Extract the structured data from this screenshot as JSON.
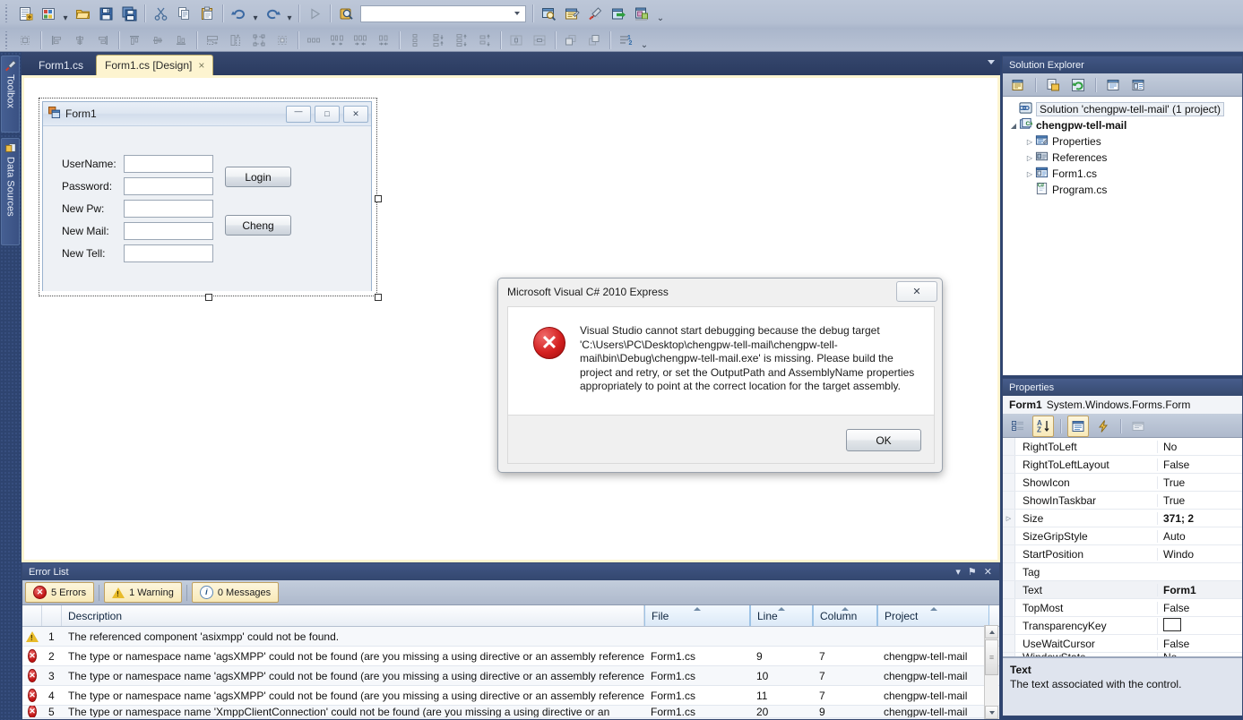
{
  "toolbars": {
    "row1_icons": [
      "new-project-icon",
      "add-new-item-icon",
      "open-file-icon",
      "save-icon",
      "save-all-icon",
      "cut-icon",
      "copy-icon",
      "paste-icon",
      "undo-icon",
      "redo-icon",
      "start-debugging-icon",
      "find-in-files-icon",
      "navigate-combo",
      "solution-explorer-icon",
      "properties-window-icon",
      "toolbox-icon",
      "object-browser-icon",
      "error-list-icon"
    ],
    "row2_icons": [
      "align-to-grid-icon",
      "align-lefts-icon",
      "align-centers-icon",
      "align-rights-icon",
      "align-tops-icon",
      "align-middles-icon",
      "align-bottoms-icon",
      "make-same-width-icon",
      "make-same-height-icon",
      "make-same-size-icon",
      "size-to-grid-icon",
      "horizontal-spacing-equal-icon",
      "horizontal-spacing-increase-icon",
      "horizontal-spacing-decrease-icon",
      "horizontal-spacing-remove-icon",
      "vertical-spacing-equal-icon",
      "vertical-spacing-increase-icon",
      "vertical-spacing-decrease-icon",
      "vertical-spacing-remove-icon",
      "center-horizontally-icon",
      "center-vertically-icon",
      "bring-to-front-icon",
      "send-to-back-icon",
      "tab-order-icon"
    ],
    "combo_value": "",
    "combo_placeholder": ""
  },
  "left_dock": {
    "tabs": [
      {
        "label": "Toolbox",
        "icon": "toolbox-icon"
      },
      {
        "label": "Data Sources",
        "icon": "data-sources-icon"
      }
    ]
  },
  "doc_tabs": [
    {
      "label": "Form1.cs",
      "active": false,
      "closable": false
    },
    {
      "label": "Form1.cs [Design]",
      "active": true,
      "closable": true,
      "close_glyph": "×"
    }
  ],
  "designer": {
    "form": {
      "title": "Form1",
      "icon": "winforms-form-icon",
      "window_buttons": [
        {
          "name": "minimize-button",
          "glyph": "—"
        },
        {
          "name": "maximize-button",
          "glyph": "□"
        },
        {
          "name": "close-button",
          "glyph": "✕"
        }
      ],
      "fields": [
        {
          "label": "UserName:",
          "value": ""
        },
        {
          "label": "Password:",
          "value": ""
        },
        {
          "label": "New Pw:",
          "value": ""
        },
        {
          "label": "New Mail:",
          "value": ""
        },
        {
          "label": "New Tell:",
          "value": ""
        }
      ],
      "buttons": [
        {
          "label": "Login"
        },
        {
          "label": "Cheng"
        }
      ]
    }
  },
  "dialog": {
    "title": "Microsoft Visual C# 2010 Express",
    "close_glyph": "✕",
    "icon": "error-icon",
    "message": "Visual Studio cannot start debugging because the debug target 'C:\\Users\\PC\\Desktop\\chengpw-tell-mail\\chengpw-tell-mail\\bin\\Debug\\chengpw-tell-mail.exe' is missing. Please build the project and retry, or set the OutputPath and AssemblyName properties appropriately to point at the correct location for the target assembly.",
    "ok_label": "OK"
  },
  "solution_explorer": {
    "title": "Solution Explorer",
    "toolbar_icons": [
      "properties-window-icon",
      "show-all-files-icon",
      "refresh-icon",
      "view-code-icon",
      "view-designer-icon"
    ],
    "tree": [
      {
        "label": "Solution 'chengpw-tell-mail' (1 project)",
        "icon": "solution-icon",
        "depth": 0,
        "twisty": "",
        "selected": true,
        "bold": false
      },
      {
        "label": "chengpw-tell-mail",
        "icon": "csharp-project-icon",
        "depth": 0,
        "twisty": "◢",
        "selected": false,
        "bold": true
      },
      {
        "label": "Properties",
        "icon": "properties-folder-icon",
        "depth": 1,
        "twisty": "▷",
        "selected": false,
        "bold": false
      },
      {
        "label": "References",
        "icon": "references-folder-icon",
        "depth": 1,
        "twisty": "▷",
        "selected": false,
        "bold": false
      },
      {
        "label": "Form1.cs",
        "icon": "form-file-icon",
        "depth": 1,
        "twisty": "▷",
        "selected": false,
        "bold": false
      },
      {
        "label": "Program.cs",
        "icon": "csharp-file-icon",
        "depth": 1,
        "twisty": "",
        "selected": false,
        "bold": false
      }
    ]
  },
  "properties": {
    "title": "Properties",
    "object_name": "Form1",
    "object_type": "System.Windows.Forms.Form",
    "toolbar_icons": [
      "categorized-icon",
      "alphabetical-icon",
      "properties-icon",
      "events-icon",
      "property-pages-icon"
    ],
    "rows": [
      {
        "name": "RightToLeft",
        "value": "No",
        "expandable": false,
        "bold": false,
        "highlight": false
      },
      {
        "name": "RightToLeftLayout",
        "value": "False",
        "expandable": false,
        "bold": false,
        "highlight": false
      },
      {
        "name": "ShowIcon",
        "value": "True",
        "expandable": false,
        "bold": false,
        "highlight": false
      },
      {
        "name": "ShowInTaskbar",
        "value": "True",
        "expandable": false,
        "bold": false,
        "highlight": false
      },
      {
        "name": "Size",
        "value": "371; 2",
        "expandable": true,
        "bold": true,
        "highlight": false
      },
      {
        "name": "SizeGripStyle",
        "value": "Auto",
        "expandable": false,
        "bold": false,
        "highlight": false
      },
      {
        "name": "StartPosition",
        "value": "Windo",
        "expandable": false,
        "bold": false,
        "highlight": false
      },
      {
        "name": "Tag",
        "value": "",
        "expandable": false,
        "bold": false,
        "highlight": false
      },
      {
        "name": "Text",
        "value": "Form1",
        "expandable": false,
        "bold": true,
        "highlight": true
      },
      {
        "name": "TopMost",
        "value": "False",
        "expandable": false,
        "bold": false,
        "highlight": false
      },
      {
        "name": "TransparencyKey",
        "value": "",
        "swatch": "#ffffff",
        "expandable": false,
        "bold": false,
        "highlight": false
      },
      {
        "name": "UseWaitCursor",
        "value": "False",
        "expandable": false,
        "bold": false,
        "highlight": false
      },
      {
        "name": "WindowState",
        "value": "No",
        "expandable": false,
        "bold": false,
        "highlight": false
      }
    ],
    "description_title": "Text",
    "description_body": "The text associated with the control."
  },
  "error_list": {
    "title": "Error List",
    "window_buttons": [
      {
        "name": "dropdown-button",
        "glyph": "▾"
      },
      {
        "name": "pin-button",
        "glyph": "⚑"
      },
      {
        "name": "close-button",
        "glyph": "✕"
      }
    ],
    "filters": [
      {
        "label": "5 Errors",
        "icon": "error-icon",
        "active": true
      },
      {
        "label": "1 Warning",
        "icon": "warning-icon",
        "active": true
      },
      {
        "label": "0 Messages",
        "icon": "info-icon",
        "active": true
      }
    ],
    "columns": [
      "",
      "",
      "Description",
      "File",
      "Line",
      "Column",
      "Project"
    ],
    "rows": [
      {
        "severity": "warning",
        "num": "1",
        "description": "The referenced component 'asixmpp' could not be found.",
        "file": "",
        "line": "",
        "column": "",
        "project": ""
      },
      {
        "severity": "error",
        "num": "2",
        "description": "The type or namespace name 'agsXMPP' could not be found (are you missing a using directive or an assembly reference?)",
        "file": "Form1.cs",
        "line": "9",
        "column": "7",
        "project": "chengpw-tell-mail"
      },
      {
        "severity": "error",
        "num": "3",
        "description": "The type or namespace name 'agsXMPP' could not be found (are you missing a using directive or an assembly reference?)",
        "file": "Form1.cs",
        "line": "10",
        "column": "7",
        "project": "chengpw-tell-mail"
      },
      {
        "severity": "error",
        "num": "4",
        "description": "The type or namespace name 'agsXMPP' could not be found (are you missing a using directive or an assembly reference?)",
        "file": "Form1.cs",
        "line": "11",
        "column": "7",
        "project": "chengpw-tell-mail"
      },
      {
        "severity": "error",
        "num": "5",
        "description": "The type or namespace name 'XmppClientConnection' could not be found (are you missing a using directive or an",
        "file": "Form1.cs",
        "line": "20",
        "column": "9",
        "project": "chengpw-tell-mail"
      }
    ]
  },
  "colors": {
    "chrome": "#2e4470",
    "toolbar": "#b4bfd2",
    "accent_tab": "#fdf4d0",
    "error_red": "#c01414",
    "warning_yellow": "#e8bb2a"
  }
}
